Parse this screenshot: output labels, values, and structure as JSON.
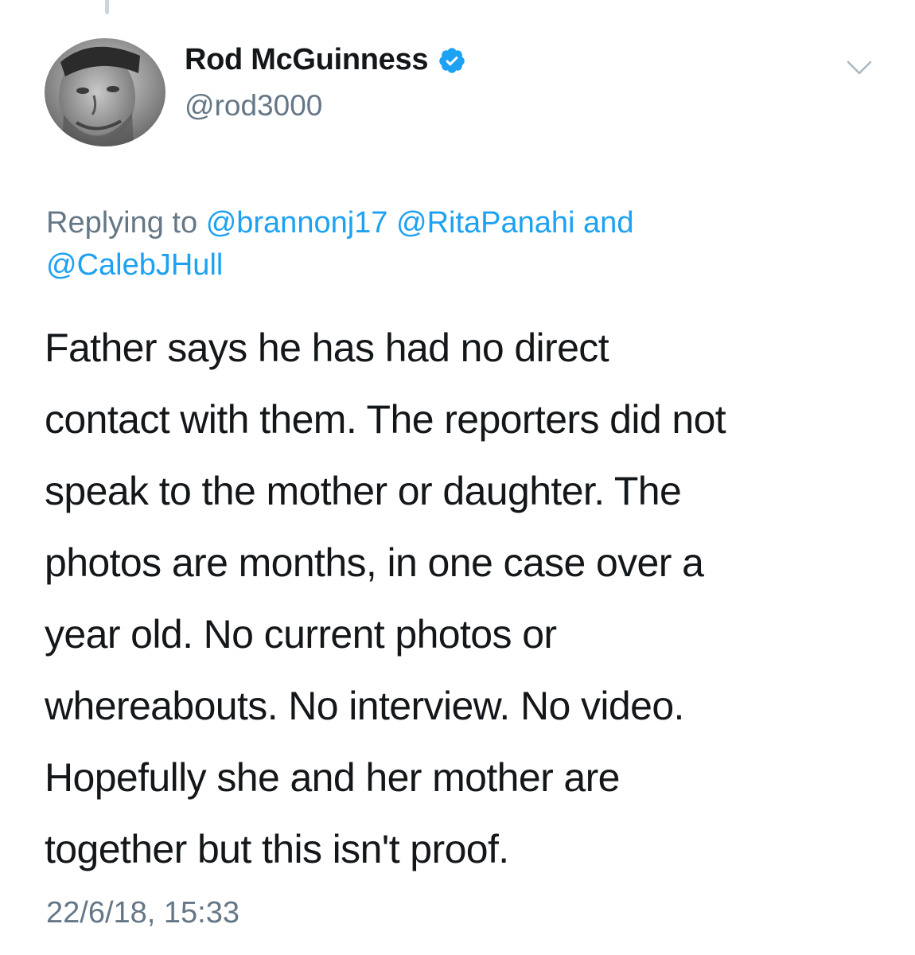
{
  "tweet": {
    "author": {
      "display_name": "Rod McGuinness",
      "handle": "@rod3000",
      "verified": true,
      "avatar": "profile-photo"
    },
    "reply_context": {
      "prefix": "Replying to",
      "mentions": [
        "@brannonj17",
        "@RitaPanahi",
        "@CalebJHull"
      ],
      "conjunction": "and"
    },
    "text_lines": [
      "Father says he has had no direct",
      "contact with them. The reporters did not",
      "speak to the mother or daughter. The",
      "photos are months, in one case over a",
      "year old. No current photos or",
      "whereabouts. No interview. No video.",
      "Hopefully she and her mother are",
      "together but this isn't proof."
    ],
    "timestamp": "22/6/18, 15:33"
  },
  "icons": {
    "verified": "verified-badge-icon",
    "menu": "chevron-down-icon"
  },
  "colors": {
    "text": "#14171a",
    "secondary": "#657786",
    "link": "#1da1f2",
    "verified": "#1da1f2"
  }
}
